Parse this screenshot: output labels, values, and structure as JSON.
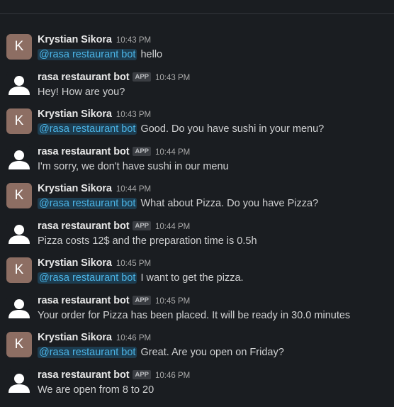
{
  "app_badge_label": "APP",
  "colors": {
    "background": "#1a1d21",
    "user_avatar": "#8d6e63",
    "mention_text": "#4bb4e6",
    "mention_bg": "#1d3c4f"
  },
  "messages": [
    {
      "sender": "Krystian Sikora",
      "avatar_letter": "K",
      "is_bot": false,
      "time": "10:43 PM",
      "mention": "@rasa restaurant bot",
      "text": "hello"
    },
    {
      "sender": "rasa restaurant bot",
      "avatar_letter": "",
      "is_bot": true,
      "time": "10:43 PM",
      "mention": "",
      "text": "Hey! How are you?"
    },
    {
      "sender": "Krystian Sikora",
      "avatar_letter": "K",
      "is_bot": false,
      "time": "10:43 PM",
      "mention": "@rasa restaurant bot",
      "text": "Good. Do you have sushi in your menu?"
    },
    {
      "sender": "rasa restaurant bot",
      "avatar_letter": "",
      "is_bot": true,
      "time": "10:44 PM",
      "mention": "",
      "text": "I'm sorry, we don't have sushi in our menu"
    },
    {
      "sender": "Krystian Sikora",
      "avatar_letter": "K",
      "is_bot": false,
      "time": "10:44 PM",
      "mention": "@rasa restaurant bot",
      "text": "What about Pizza. Do you have Pizza?"
    },
    {
      "sender": "rasa restaurant bot",
      "avatar_letter": "",
      "is_bot": true,
      "time": "10:44 PM",
      "mention": "",
      "text": "Pizza costs 12$ and the preparation time is 0.5h"
    },
    {
      "sender": "Krystian Sikora",
      "avatar_letter": "K",
      "is_bot": false,
      "time": "10:45 PM",
      "mention": "@rasa restaurant bot",
      "text": "I want to get the pizza."
    },
    {
      "sender": "rasa restaurant bot",
      "avatar_letter": "",
      "is_bot": true,
      "time": "10:45 PM",
      "mention": "",
      "text": "Your order for Pizza has been placed. It will be ready in 30.0 minutes"
    },
    {
      "sender": "Krystian Sikora",
      "avatar_letter": "K",
      "is_bot": false,
      "time": "10:46 PM",
      "mention": "@rasa restaurant bot",
      "text": "Great. Are you open on Friday?"
    },
    {
      "sender": "rasa restaurant bot",
      "avatar_letter": "",
      "is_bot": true,
      "time": "10:46 PM",
      "mention": "",
      "text": "We are open from 8 to 20"
    }
  ]
}
